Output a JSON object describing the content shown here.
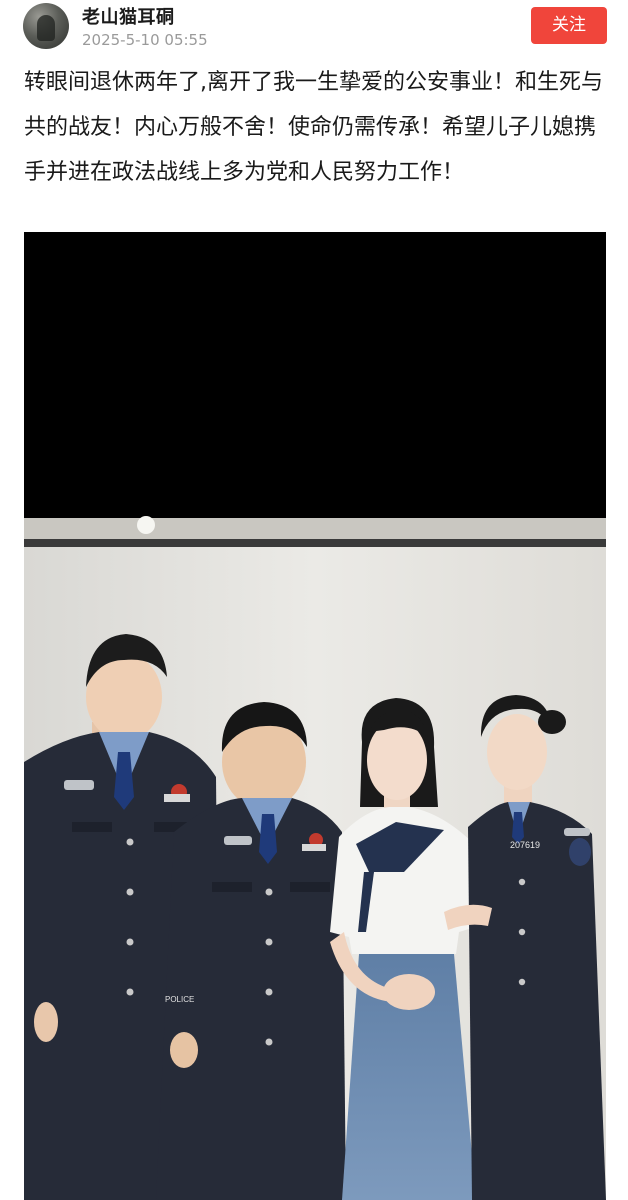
{
  "post": {
    "author": {
      "name": "老山猫耳硐",
      "avatar_icon": "avatar-photo"
    },
    "timestamp": "2025-5-10 05:55",
    "follow_label": "关注",
    "text": "转眼间退休两年了,离开了我一生挚爱的公安事业！和生死与共的战友！内心万般不舍！使命仍需传承！希望儿子儿媳携手并进在政法战线上多为党和人民努力工作！",
    "photo": {
      "police_number": "207619",
      "chest_badge_text": "POLICE"
    }
  },
  "colors": {
    "follow_button": "#f0453b",
    "timestamp": "#9a9a9a",
    "uniform": "#262b38",
    "shirt": "#7e9cc8"
  }
}
